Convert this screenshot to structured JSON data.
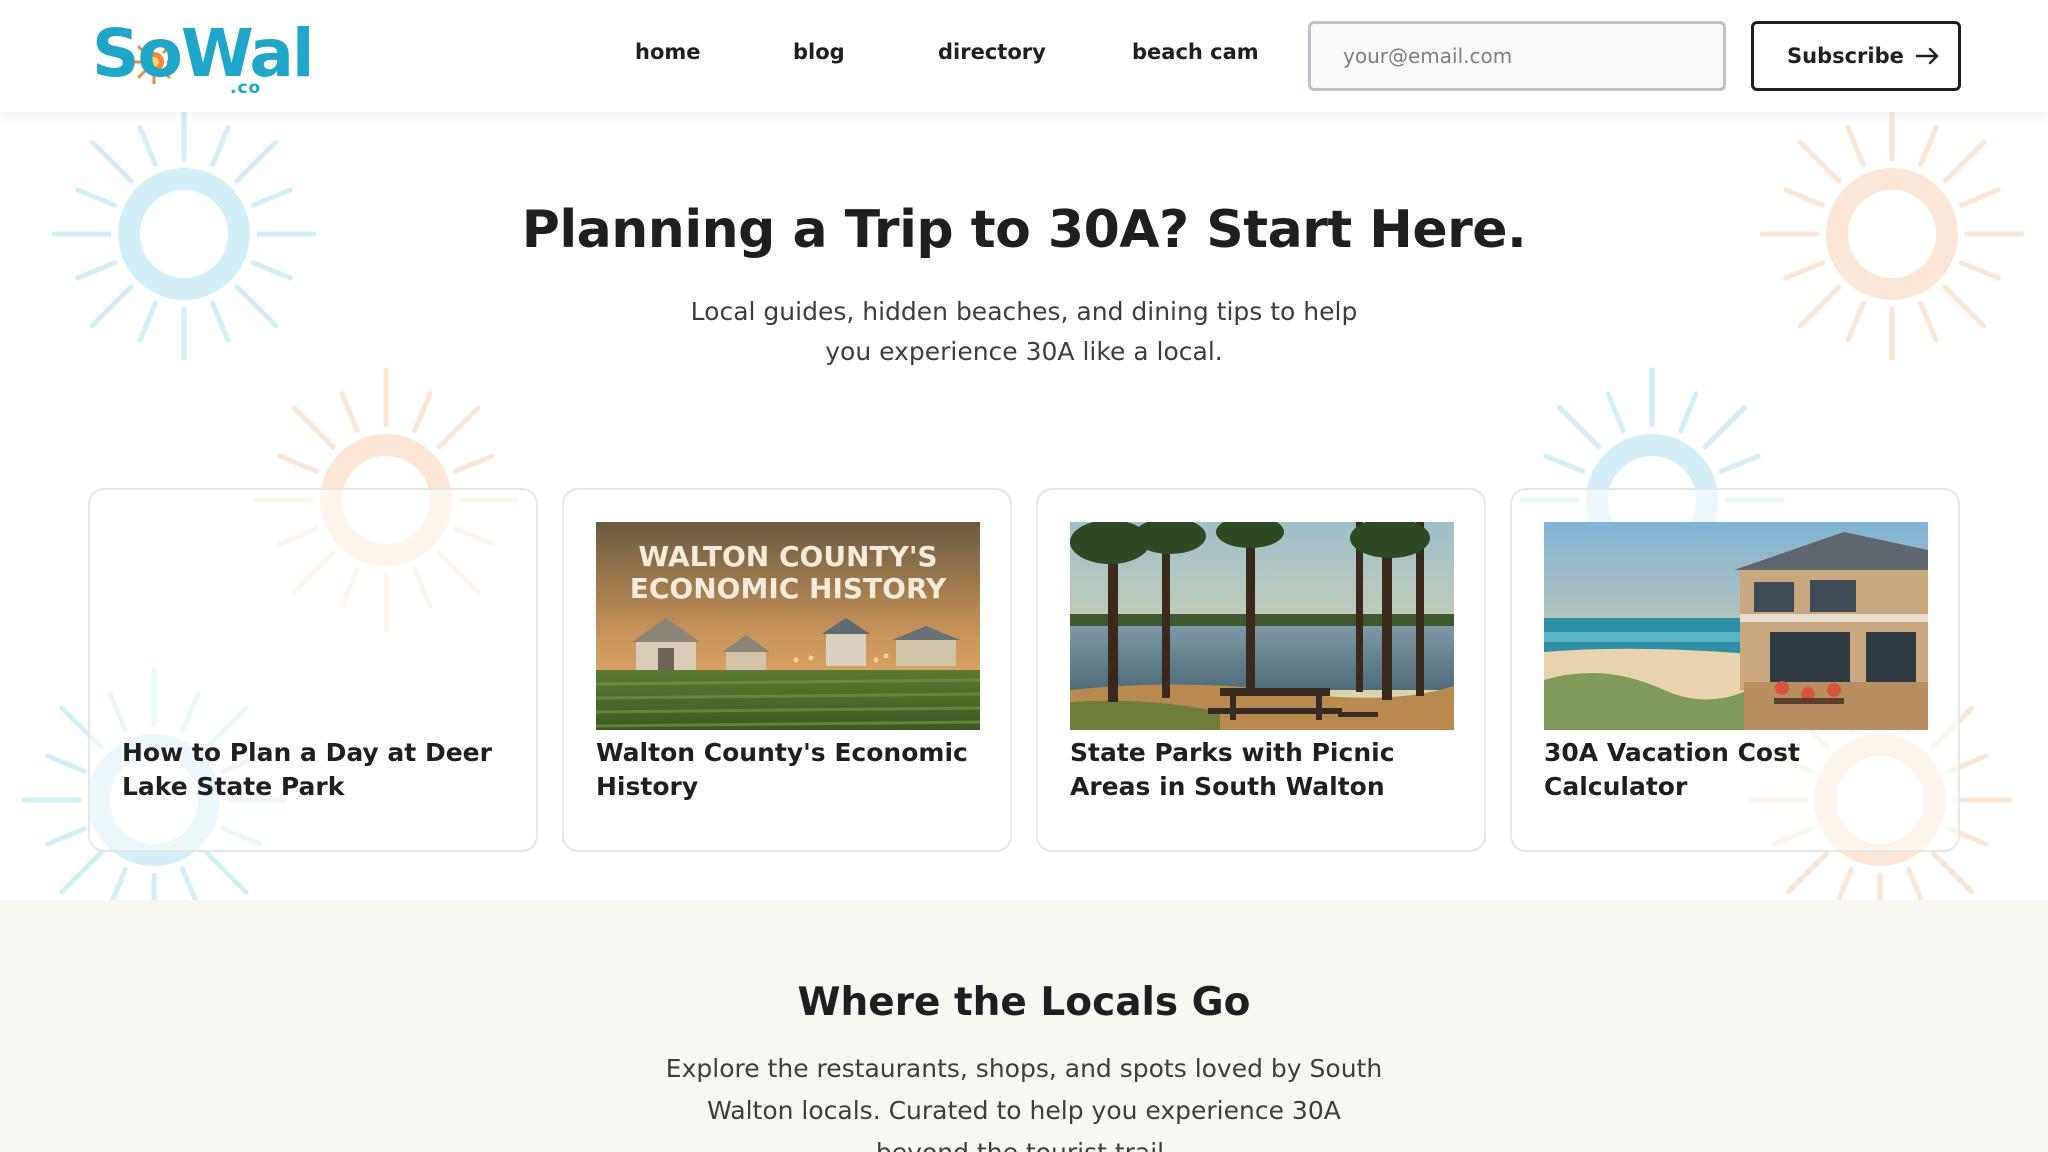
{
  "header": {
    "logo": {
      "text": "SoWal",
      "suffix": ".co"
    },
    "nav": [
      {
        "label": "home"
      },
      {
        "label": "blog"
      },
      {
        "label": "directory"
      },
      {
        "label": "beach cam"
      }
    ],
    "email": {
      "placeholder": "your@email.com",
      "value": ""
    },
    "subscribe_label": "Subscribe"
  },
  "hero": {
    "title": "Planning a Trip to 30A? Start Here.",
    "subtitle": "Local guides, hidden beaches, and dining tips to help you experience 30A like a local."
  },
  "cards": [
    {
      "title": "How to Plan a Day at Deer Lake State Park",
      "image": "none"
    },
    {
      "title": "Walton County's Economic History",
      "image": "farm-town-illustration",
      "image_text": [
        "WALTON COUNTY'S",
        "ECONOMIC HISTORY"
      ]
    },
    {
      "title": "State Parks with Picnic Areas in South Walton",
      "image": "lake-pines-picnic-photo"
    },
    {
      "title": "30A Vacation Cost Calculator",
      "image": "beach-house-photo"
    }
  ],
  "locals": {
    "title": "Where the Locals Go",
    "subtitle": "Explore the restaurants, shops, and spots loved by South Walton locals. Curated to help you experience 30A beyond the tourist trail."
  },
  "colors": {
    "brand_teal": "#1fa6c8",
    "brand_orange": "#f08a3c",
    "text_dark": "#1f1f1f",
    "section_bg": "#f8f7f1"
  },
  "icons": {
    "subscribe": "arrow-right-icon",
    "logo_mark": "sun-icon",
    "decoration": "sunburst-icon"
  }
}
